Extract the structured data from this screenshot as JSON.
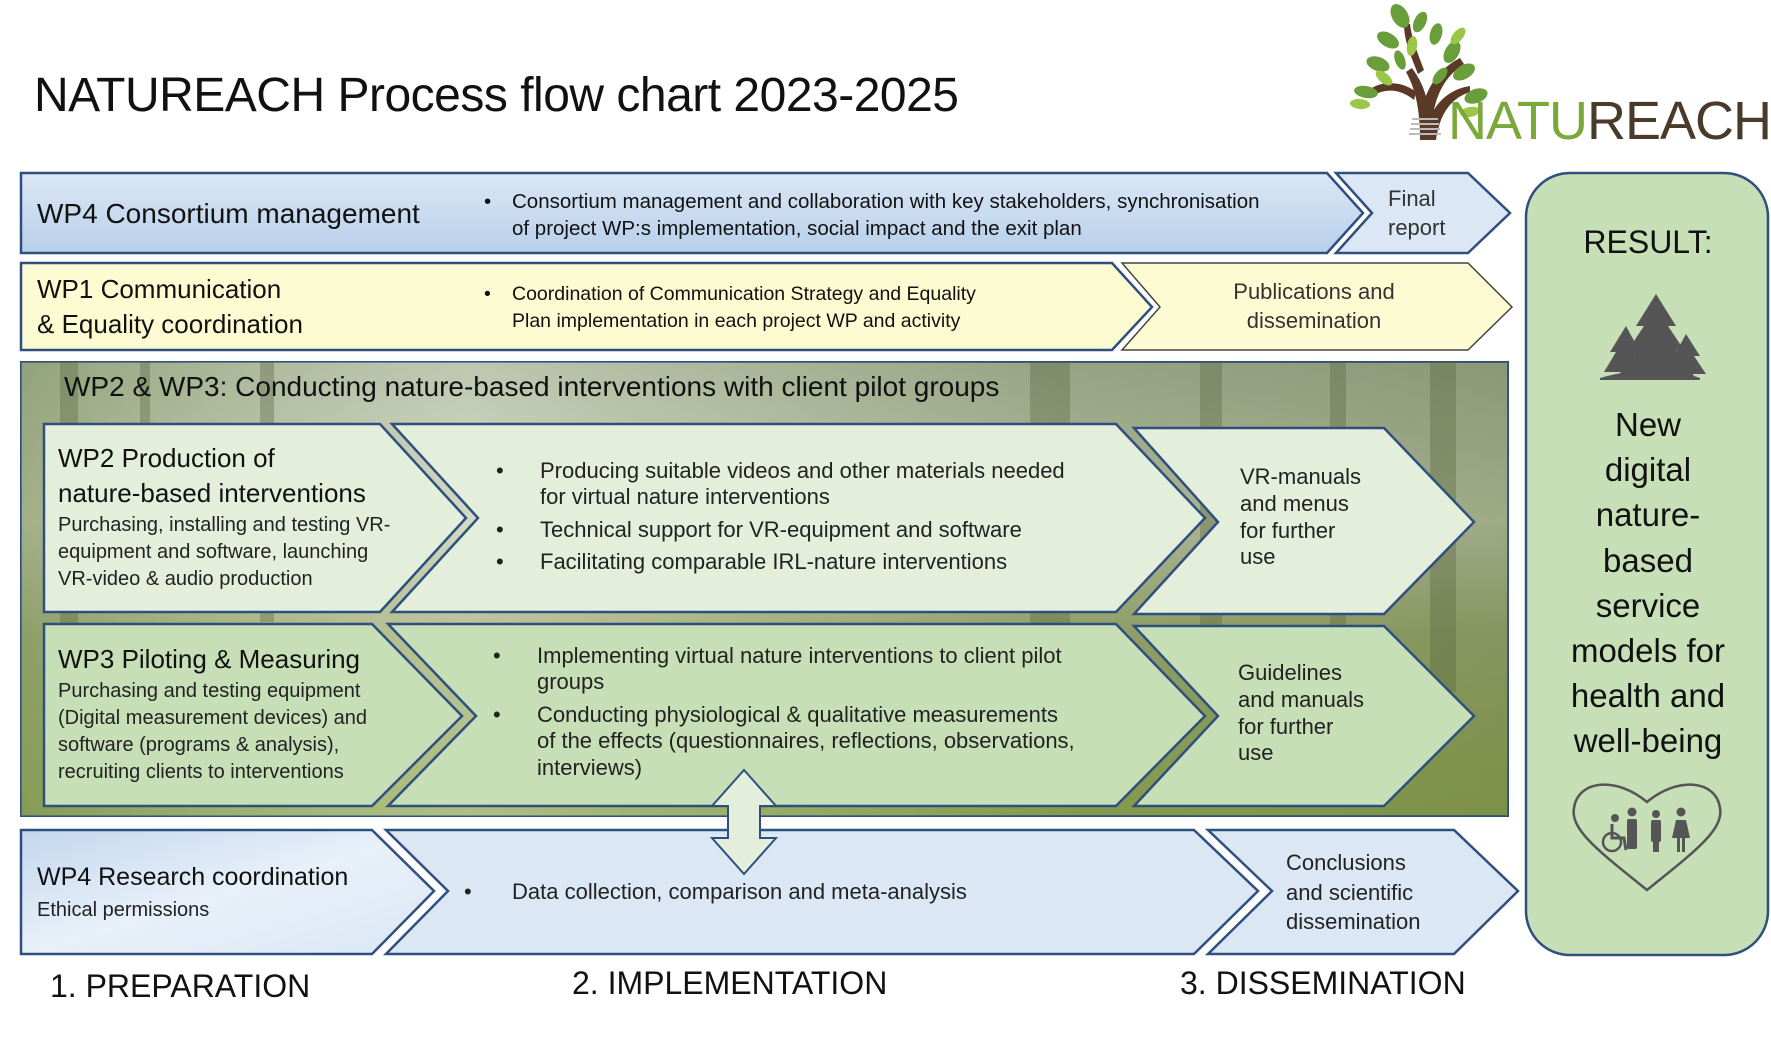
{
  "title": "NATUREACH Process flow chart 2023-2025",
  "logo": {
    "text_part1": "NATU",
    "text_part2": "REACH",
    "icon": "tree-icon"
  },
  "colors": {
    "border": "#2f4f7f",
    "blue_fill": "#dbe7f5",
    "yellow_fill": "#fdfbd2",
    "light_green_fill": "#e3eedb",
    "green_fill": "#c6dfb6",
    "result_fill": "#c6dfb6",
    "logo_green": "#7aa83a",
    "logo_brown": "#4a3a2a"
  },
  "rows": {
    "wp4_consortium": {
      "heading": "WP4 Consortium management",
      "bullets": [
        "Consortium management and collaboration with key stakeholders, synchronisation of project WP:s implementation, social impact and the exit plan"
      ],
      "bullet_lines": [
        "Consortium management and collaboration with key stakeholders, synchronisation",
        "of project WP:s implementation, social impact and the exit plan"
      ],
      "output_lines": [
        "Final",
        "report"
      ]
    },
    "wp1_communication": {
      "heading_lines": [
        "WP1 Communication",
        "& Equality coordination"
      ],
      "bullet_lines": [
        "Coordination of Communication Strategy and Equality",
        "Plan implementation in each project WP and activity"
      ],
      "output_lines": [
        "Publications and",
        "dissemination"
      ]
    },
    "wp2_wp3_section": {
      "heading": "WP2 & WP3: Conducting nature-based interventions with client pilot groups"
    },
    "wp2_production": {
      "heading_lines": [
        "WP2 Production of",
        "nature-based interventions"
      ],
      "sub_lines": [
        "Purchasing, installing and testing VR-",
        "equipment and software, launching",
        "VR-video & audio production"
      ],
      "bullets": [
        [
          "Producing suitable videos and other materials needed",
          "for virtual nature interventions"
        ],
        [
          "Technical support for VR-equipment and software"
        ],
        [
          "Facilitating comparable IRL-nature interventions"
        ]
      ],
      "output_lines": [
        "VR-manuals",
        "and menus",
        "for further",
        "use"
      ]
    },
    "wp3_piloting": {
      "heading": "WP3 Piloting & Measuring",
      "sub_lines": [
        "Purchasing and testing equipment",
        "(Digital measurement devices) and",
        "software (programs & analysis),",
        "recruiting clients to interventions"
      ],
      "bullets": [
        [
          "Implementing virtual nature interventions to client pilot",
          "groups"
        ],
        [
          "Conducting physiological & qualitative measurements",
          "of the effects (questionnaires, reflections, observations,",
          "interviews)"
        ]
      ],
      "output_lines": [
        "Guidelines",
        "and manuals",
        "for further",
        "use"
      ]
    },
    "wp4_research": {
      "heading": "WP4 Research coordination",
      "sub": "Ethical permissions",
      "bullets": [
        "Data collection, comparison and meta-analysis"
      ],
      "output_lines": [
        "Conclusions",
        "and scientific",
        "dissemination"
      ]
    }
  },
  "result": {
    "title": "RESULT:",
    "icon_trees": "forest-icon",
    "body_lines": [
      "New",
      "digital",
      "nature-",
      "based",
      "service",
      "models for",
      "health and",
      "well-being"
    ],
    "icon_people": "heart-people-icon"
  },
  "phases": [
    "1. PREPARATION",
    "2. IMPLEMENTATION",
    "3. DISSEMINATION"
  ]
}
